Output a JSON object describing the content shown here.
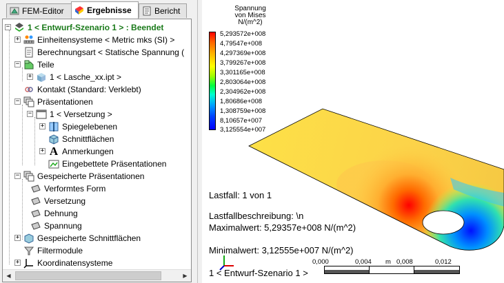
{
  "tabs": [
    {
      "label": "FEM-Editor",
      "active": false
    },
    {
      "label": "Ergebnisse",
      "active": true
    },
    {
      "label": "Bericht",
      "active": false
    }
  ],
  "tree": {
    "root": "1 < Entwurf-Szenario 1 > : Beendet",
    "units": "Einheitensysteme < Metric mks (SI) >",
    "analysis": "Berechnungsart < Statische Spannung (",
    "parts": "Teile",
    "part_file": "1 < Lasche_xx.ipt >",
    "contact": "Kontakt (Standard: Verklebt)",
    "presentations": "Präsentationen",
    "pres_1": "1 < Versetzung >",
    "mirror_planes": "Spiegelebenen",
    "sections": "Schnittflächen",
    "annotations": "Anmerkungen",
    "embedded": "Eingebettete Präsentationen",
    "saved_pres": "Gespeicherte Präsentationen",
    "deformed": "Verformtes Form",
    "displacement": "Versetzung",
    "strain": "Dehnung",
    "stress": "Spannung",
    "saved_sections": "Gespeicherte Schnittflächen",
    "filter": "Filtermodule",
    "coords": "Koordinatensysteme"
  },
  "legend": {
    "title_line1": "Spannung",
    "title_line2": "von Mises",
    "title_line3": "N/(m^2)",
    "values": [
      "5,293572e+008",
      "4,79547e+008",
      "4,297369e+008",
      "3,799267e+008",
      "3,301165e+008",
      "2,803064e+008",
      "2,304962e+008",
      "1,80686e+008",
      "1,308759e+008",
      "8,10657e+007",
      "3,125554e+007"
    ]
  },
  "info": {
    "loadcase": "Lastfall: 1 von 1",
    "description": "Lastfallbeschreibung: \\n",
    "max": "Maximalwert: 5,29357e+008 N/(m^2)",
    "min": "Minimalwert: 3,12555e+007 N/(m^2)",
    "scenario": "1 < Entwurf-Szenario 1 >"
  },
  "scale": {
    "ticks": [
      "0,000",
      "0,004",
      "m",
      "0,008",
      "0,012"
    ]
  },
  "colors": {
    "root_text": "#1a7a1a",
    "scale_dark": "#555555"
  }
}
